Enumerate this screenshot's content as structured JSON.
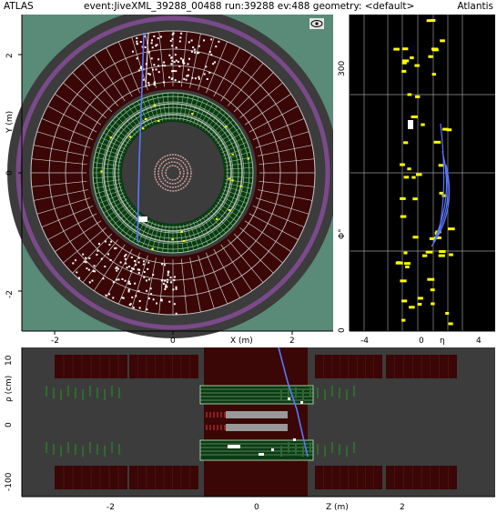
{
  "titlebar": {
    "left": "ATLAS",
    "center": "event:JiveXML_39288_00488 run:39288 ev:488 geometry: <default>",
    "right": "Atlantis"
  },
  "xy_view": {
    "x_ticks": [
      "-2",
      "0",
      "2"
    ],
    "x_label": "X (m)",
    "y_ticks": [
      "2",
      "0",
      "-2"
    ],
    "y_label": "Y (m)",
    "eye_icon": "eye-icon"
  },
  "phi_eta_view": {
    "x_ticks": [
      "-4",
      "0",
      "4"
    ],
    "x_label": "η",
    "y_ticks": [
      "300",
      "0"
    ],
    "y_label": "Φ°"
  },
  "rz_view": {
    "x_ticks": [
      "-2",
      "0",
      "2"
    ],
    "x_label": "Z (m)",
    "y_ticks": [
      "10",
      "0",
      "-100"
    ],
    "y_label": "ρ (cm)"
  },
  "colors": {
    "outer_bg": "#5a8a78",
    "ring_dark": "#3c3c3c",
    "calo_fill": "#3a0606",
    "calo_grid": "#c8c8c8",
    "trt_green": "#9ecf9e",
    "track_blue": "#5a78ff",
    "hit_yellow": "#ffff00",
    "purple_ring": "#7a4a8a"
  }
}
